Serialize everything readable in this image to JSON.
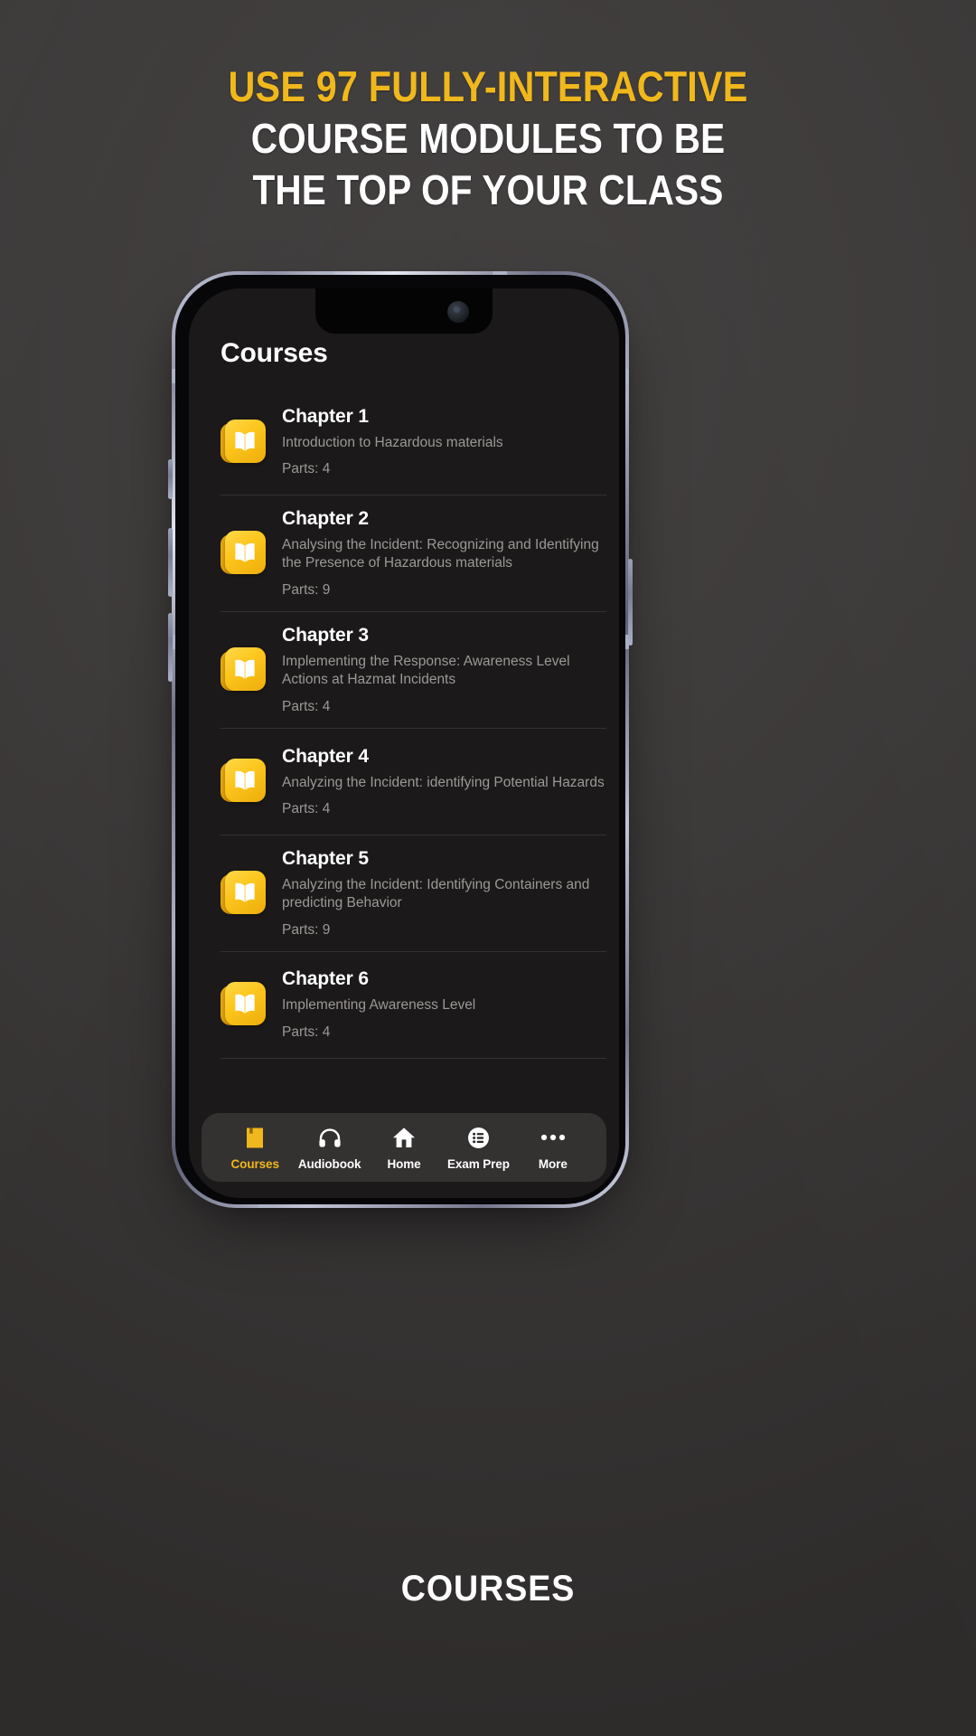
{
  "headline": {
    "line1": "USE 97 FULLY-INTERACTIVE",
    "line2": "COURSE MODULES TO BE",
    "line3": "THE TOP OF YOUR CLASS",
    "accent_color": "#f0b81c",
    "text_color": "#ffffff"
  },
  "caption": "COURSES",
  "app": {
    "title": "Courses",
    "background_color": "#1b1919",
    "accent_color": "#f0b81c",
    "courses": [
      {
        "title": "Chapter 1",
        "description": "Introduction to Hazardous materials",
        "parts": "Parts: 4",
        "icon": "book-icon"
      },
      {
        "title": "Chapter 2",
        "description": "Analysing the Incident: Recognizing and Identifying the Presence of Hazardous materials",
        "parts": "Parts: 9",
        "icon": "book-icon"
      },
      {
        "title": "Chapter 3",
        "description": "Implementing the Response: Awareness Level Actions at Hazmat Incidents",
        "parts": "Parts: 4",
        "icon": "book-icon"
      },
      {
        "title": "Chapter 4",
        "description": "Analyzing the Incident: identifying Potential Hazards",
        "parts": "Parts: 4",
        "icon": "book-icon"
      },
      {
        "title": "Chapter 5",
        "description": "Analyzing the Incident: Identifying Containers and predicting Behavior",
        "parts": "Parts: 9",
        "icon": "book-icon"
      },
      {
        "title": "Chapter 6",
        "description": "Implementing Awareness Level",
        "parts": "Parts: 4",
        "icon": "book-icon"
      }
    ],
    "tabs": [
      {
        "label": "Courses",
        "icon": "bookmark-book-icon",
        "active": true
      },
      {
        "label": "Audiobook",
        "icon": "headphones-icon",
        "active": false
      },
      {
        "label": "Home",
        "icon": "house-icon",
        "active": false
      },
      {
        "label": "Exam Prep",
        "icon": "list-circle-icon",
        "active": false
      },
      {
        "label": "More",
        "icon": "ellipsis-icon",
        "active": false
      }
    ]
  }
}
